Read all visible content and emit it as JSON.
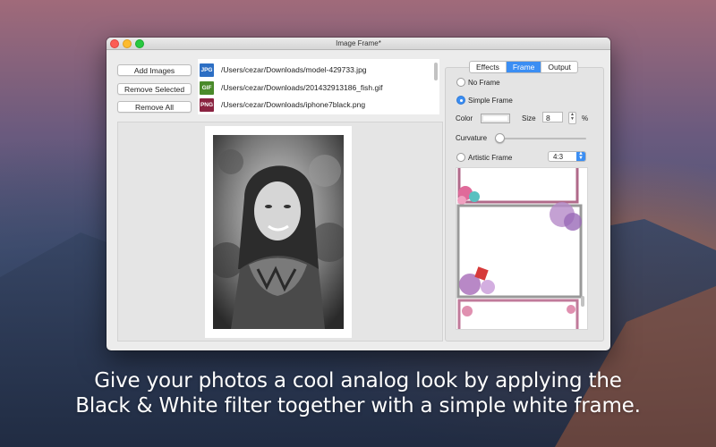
{
  "window": {
    "title": "Image Frame*"
  },
  "file_buttons": {
    "add": "Add Images",
    "remove_selected": "Remove Selected",
    "remove_all": "Remove All"
  },
  "files": [
    {
      "type": "JPG",
      "path": "/Users/cezar/Downloads/model-429733.jpg",
      "color": "#2d6fc4"
    },
    {
      "type": "GIF",
      "path": "/Users/cezar/Downloads/201432913186_fish.gif",
      "color": "#4a8a2a"
    },
    {
      "type": "PNG",
      "path": "/Users/cezar/Downloads/iphone7black.png",
      "color": "#8a2240"
    }
  ],
  "tabs": [
    "Effects",
    "Frame",
    "Output"
  ],
  "frame": {
    "no_frame": "No Frame",
    "simple_frame": "Simple Frame",
    "color_label": "Color",
    "size_label": "Size",
    "size_value": "8",
    "percent": "%",
    "curvature_label": "Curvature",
    "curvature_level": 0,
    "artistic_frame": "Artistic Frame",
    "ratio": "4:3"
  },
  "caption": {
    "line1": "Give your photos a cool analog look by applying the",
    "line2": "Black & White filter together with a simple white frame."
  },
  "colors": {
    "accent": "#3b8ef3",
    "frame": "#ffffff"
  }
}
